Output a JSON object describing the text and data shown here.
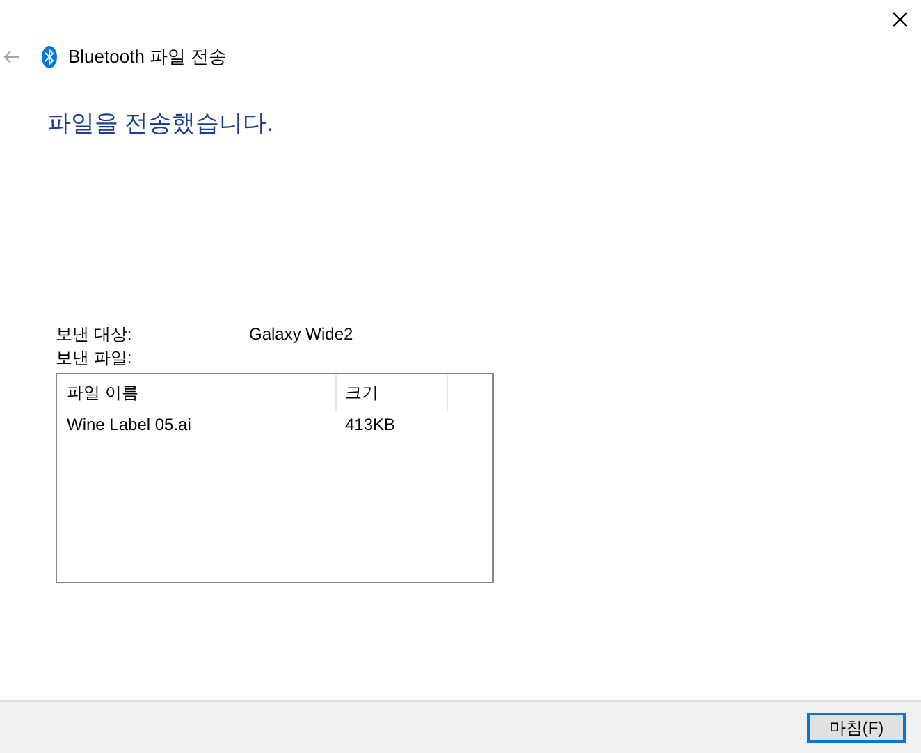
{
  "window": {
    "title": "Bluetooth 파일 전송"
  },
  "heading": "파일을 전송했습니다.",
  "fields": [
    {
      "label": "보낸 대상:",
      "value": "Galaxy Wide2"
    },
    {
      "label": "보낸 파일:"
    }
  ],
  "table": {
    "columns": [
      "파일 이름",
      "크기"
    ],
    "rows": [
      [
        "Wine Label 05.ai",
        "413KB"
      ]
    ]
  },
  "buttons": [
    "마침(F)"
  ]
}
